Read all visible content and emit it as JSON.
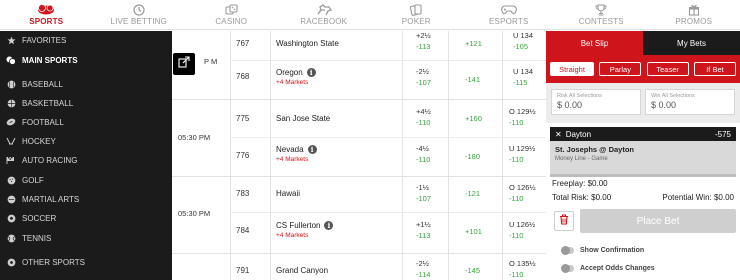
{
  "nav": [
    {
      "label": "SPORTS",
      "icon": "sports-icon",
      "active": true
    },
    {
      "label": "LIVE BETTING",
      "icon": "clock-icon",
      "active": false
    },
    {
      "label": "CASINO",
      "icon": "dice-icon",
      "active": false
    },
    {
      "label": "RACEBOOK",
      "icon": "horse-icon",
      "active": false
    },
    {
      "label": "POKER",
      "icon": "cards-icon",
      "active": false
    },
    {
      "label": "ESPORTS",
      "icon": "gamepad-icon",
      "active": false
    },
    {
      "label": "CONTESTS",
      "icon": "trophy-icon",
      "active": false
    },
    {
      "label": "PROMOS",
      "icon": "gift-icon",
      "active": false
    }
  ],
  "sidebar": {
    "items": [
      {
        "label": "FAVORITES",
        "icon": "star-icon"
      },
      {
        "label": "MAIN SPORTS",
        "icon": "main-sports-icon",
        "bold": true
      },
      {
        "label": "BASEBALL",
        "icon": "baseball-icon"
      },
      {
        "label": "BASKETBALL",
        "icon": "basketball-icon"
      },
      {
        "label": "FOOTBALL",
        "icon": "football-icon"
      },
      {
        "label": "HOCKEY",
        "icon": "hockey-icon"
      },
      {
        "label": "AUTO RACING",
        "icon": "auto-racing-icon"
      },
      {
        "label": "GOLF",
        "icon": "golf-icon"
      },
      {
        "label": "MARTIAL ARTS",
        "icon": "martial-arts-icon"
      },
      {
        "label": "SOCCER",
        "icon": "soccer-icon"
      },
      {
        "label": "TENNIS",
        "icon": "tennis-icon"
      },
      {
        "label": "OTHER SPORTS",
        "icon": "other-sports-icon"
      }
    ]
  },
  "games": [
    {
      "time": "P M",
      "teams": [
        {
          "rot": "767",
          "name": "Washington State",
          "info": false,
          "markets": "",
          "spread": "+2½",
          "spread_odds": "-113",
          "ml": "+121",
          "total": "U 134",
          "total_odds": "-105"
        },
        {
          "rot": "768",
          "name": "Oregon",
          "info": true,
          "markets": "+4 Markets",
          "spread": "-2½",
          "spread_odds": "-107",
          "ml": "-141",
          "total": "U 134",
          "total_odds": "-115"
        }
      ]
    },
    {
      "time": "05:30 PM",
      "teams": [
        {
          "rot": "775",
          "name": "San Jose State",
          "info": false,
          "markets": "",
          "spread": "+4½",
          "spread_odds": "-110",
          "ml": "+160",
          "total": "O 129½",
          "total_odds": "-110"
        },
        {
          "rot": "776",
          "name": "Nevada",
          "info": true,
          "markets": "+4 Markets",
          "spread": "-4½",
          "spread_odds": "-110",
          "ml": "-180",
          "total": "U 129½",
          "total_odds": "-110"
        }
      ]
    },
    {
      "time": "05:30 PM",
      "teams": [
        {
          "rot": "783",
          "name": "Hawaii",
          "info": false,
          "markets": "",
          "spread": "-1½",
          "spread_odds": "-107",
          "ml": "-121",
          "total": "O 126½",
          "total_odds": "-110"
        },
        {
          "rot": "784",
          "name": "CS Fullerton",
          "info": true,
          "markets": "+4 Markets",
          "spread": "+1½",
          "spread_odds": "-113",
          "ml": "+101",
          "total": "U 126½",
          "total_odds": "-110"
        }
      ]
    },
    {
      "time": "05:30 PM",
      "teams": [
        {
          "rot": "791",
          "name": "Grand Canyon",
          "info": false,
          "markets": "",
          "spread": "-2½",
          "spread_odds": "-114",
          "ml": "-145",
          "total": "O 135½",
          "total_odds": "-110"
        }
      ]
    }
  ],
  "betslip": {
    "tab_slip": "Bet Slip",
    "tab_mybets": "My Bets",
    "types": [
      "Straight",
      "Parlay",
      "Teaser",
      "If Bet"
    ],
    "risk_label": "Risk All Selections",
    "risk_value": "$ 0.00",
    "win_label": "Win All Selections",
    "win_value": "$ 0.00",
    "selection_team": "Dayton",
    "selection_odds": "-575",
    "selection_match": "St. Josephs @ Dayton",
    "selection_type": "Money Line - Game",
    "freeplay": "Freeplay: $0.00",
    "total_risk": "Total Risk: $0.00",
    "potential_win": "Potential Win: $0.00",
    "place_bet": "Place Bet",
    "show_confirmation": "Show Confirmation",
    "accept_odds": "Accept Odds Changes"
  },
  "colors": {
    "accent": "#d0141c",
    "green": "#37a43a",
    "dark": "#1b1b1b"
  }
}
